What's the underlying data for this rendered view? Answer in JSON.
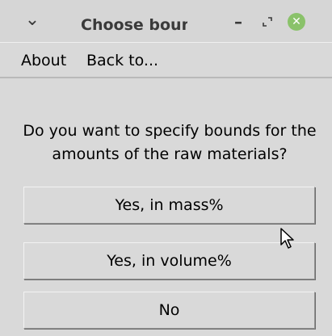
{
  "window": {
    "title": "Choose bounc",
    "menu_icon": "chevron-down-icon",
    "minimize_icon": "minimize-icon",
    "maximize_icon": "maximize-icon",
    "close_icon": "close-icon",
    "close_color": "#8ac26a"
  },
  "menubar": {
    "items": [
      "About",
      "Back to..."
    ]
  },
  "dialog": {
    "question": "Do you want to specify bounds for the amounts of the raw materials?",
    "buttons": [
      "Yes, in mass%",
      "Yes, in volume%",
      "No"
    ]
  }
}
